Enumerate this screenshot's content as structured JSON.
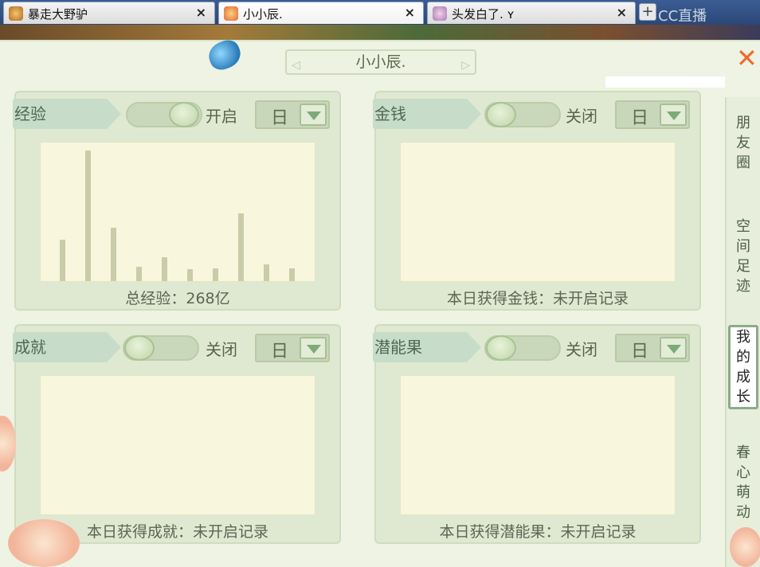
{
  "tabs": [
    {
      "label": "暴走大野驴",
      "close": "×",
      "active": false
    },
    {
      "label": "小小辰.",
      "close": "×",
      "active": true
    },
    {
      "label": "头发白了. ʏ",
      "close": "×",
      "active": false
    }
  ],
  "newtab_label": "+",
  "watermark": "CC直播",
  "window": {
    "title": "小小辰.",
    "close_glyph": "✕"
  },
  "cards": [
    {
      "tag": "经验",
      "toggle_label": "开启",
      "toggle_on": true,
      "period": "日",
      "caption": "总经验：268亿",
      "bars": [
        0.32,
        1.0,
        0.41,
        0.11,
        0.18,
        0.09,
        0.1,
        0.52,
        0.13,
        0.1
      ]
    },
    {
      "tag": "金钱",
      "toggle_label": "关闭",
      "toggle_on": false,
      "period": "日",
      "caption": "本日获得金钱：未开启记录"
    },
    {
      "tag": "成就",
      "toggle_label": "关闭",
      "toggle_on": false,
      "period": "日",
      "caption": "本日获得成就：未开启记录"
    },
    {
      "tag": "潜能果",
      "toggle_label": "关闭",
      "toggle_on": false,
      "period": "日",
      "caption": "本日获得潜能果：未开启记录"
    }
  ],
  "sidebar": {
    "items": [
      {
        "label": "朋友圈",
        "active": false
      },
      {
        "label": "空间足迹",
        "active": false
      },
      {
        "label": "我的成长",
        "active": true
      },
      {
        "label": "春心萌动",
        "active": false
      }
    ]
  },
  "colors": {
    "accent_close": "#ee6a2a",
    "panel_bg": "#eef3e4",
    "plot_bg": "#f8f6dc",
    "bar": "#c9cca8"
  }
}
